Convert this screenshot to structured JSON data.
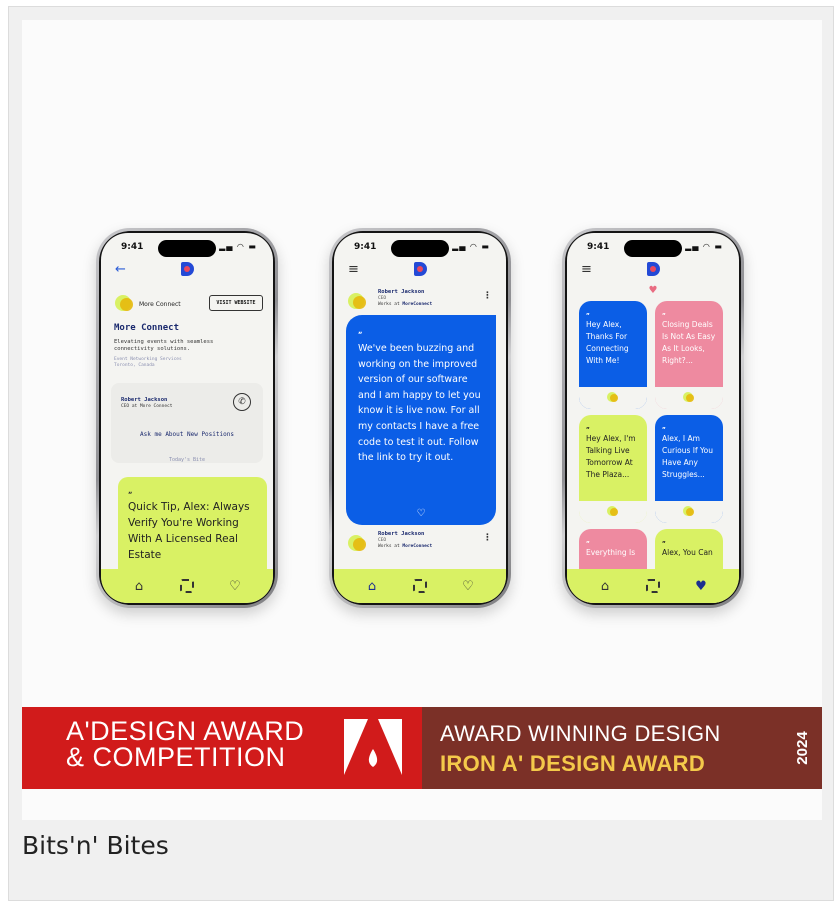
{
  "caption": "Bits'n' Bites",
  "phones": {
    "status_time": "9:41",
    "status_icons": "▐▲▬",
    "phone1": {
      "company_small": "More Connect",
      "visit_button": "VISIT WEBSITE",
      "title": "More Connect",
      "description": "Elevating events with seamless connectivity solutions.",
      "meta_line1": "Event Networking Services",
      "meta_line2": "Toronto, Canada",
      "contact_name": "Robert Jackson",
      "contact_role": "CEO at More Connect",
      "ask_text": "Ask me About New Positions",
      "todays_bite": "Today's Bite",
      "quote": "„",
      "bite_text": "Quick Tip, Alex: Always Verify You're Working With A Licensed Real Estate"
    },
    "phone2": {
      "poster_name": "Robert Jackson",
      "poster_role": "CEO",
      "works_at_prefix": "Works at",
      "works_at_company": "MoreConnect",
      "quote": "„",
      "post_text": "We've been buzzing and working on the improved version of our software and I am happy to let you know it is live now. For all my contacts I have a free code to test it out. Follow the link to try it out."
    },
    "phone3": {
      "cards": [
        {
          "quote": "„",
          "text": "Hey Alex, Thanks For Connecting With Me!",
          "color": "#0b5ee6"
        },
        {
          "quote": "„",
          "text": "Closing Deals Is Not As Easy As It Looks, Right?...",
          "color": "#ee8aa0"
        },
        {
          "quote": "„",
          "text": "Hey Alex, I'm Talking Live Tomorrow At The Plaza...",
          "color": "#d9f164"
        },
        {
          "quote": "„",
          "text": "Alex, I Am Curious If You Have Any Struggles...",
          "color": "#0b5ee6"
        },
        {
          "quote": "„",
          "text": "Everything Is",
          "color": "#ee8aa0"
        },
        {
          "quote": "„",
          "text": "Alex, You Can",
          "color": "#d9f164"
        }
      ]
    }
  },
  "banner": {
    "left_line1": "A'DESIGN AWARD",
    "left_line2": "& COMPETITION",
    "right_line1": "AWARD WINNING DESIGN",
    "right_line2": "IRON A' DESIGN AWARD",
    "year": "2024"
  },
  "colors": {
    "lime": "#d9f164",
    "blue": "#0b5ee6",
    "pink": "#ee8aa0",
    "award_red": "#d11b1b",
    "award_brown": "#7b3027",
    "award_gold": "#f4c94a"
  },
  "icons": [
    "back-arrow-icon",
    "menu-icon",
    "home-icon",
    "qr-code-icon",
    "heart-icon",
    "phone-icon",
    "more-dots-icon"
  ]
}
